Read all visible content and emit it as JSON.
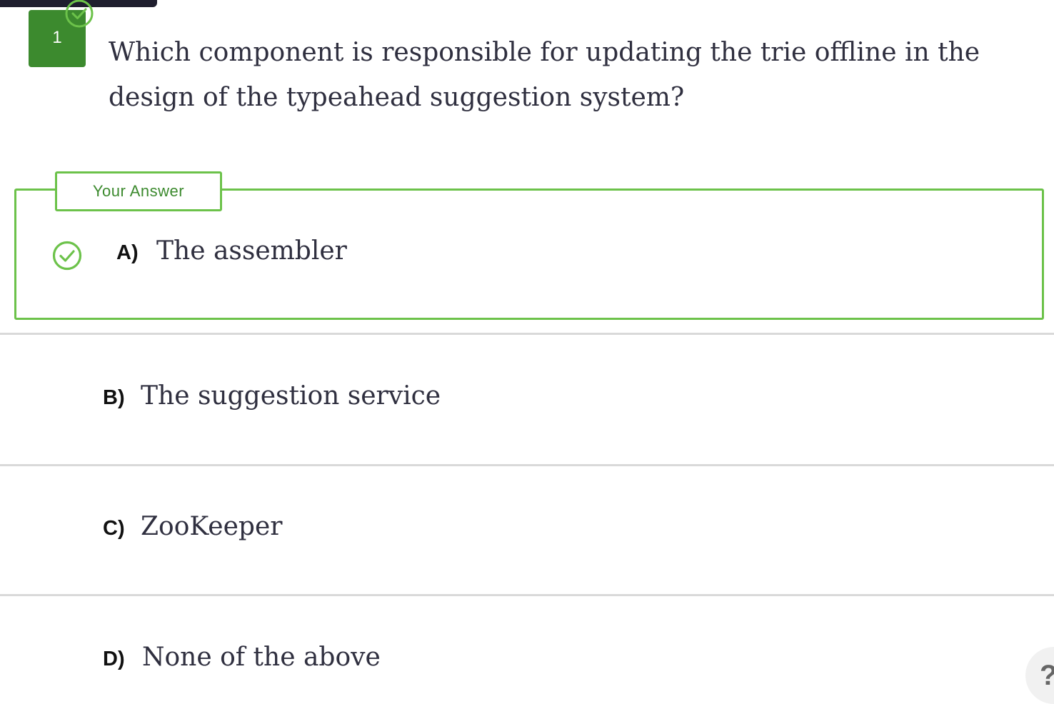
{
  "question": {
    "number": "1",
    "text": "Which component is responsible for updating the trie offline in the design of the typeahead suggestion system?"
  },
  "your_answer_label": "Your Answer",
  "options": [
    {
      "letter": "A)",
      "text": "The assembler",
      "selected": true,
      "correct": true
    },
    {
      "letter": "B)",
      "text": "The suggestion service",
      "selected": false
    },
    {
      "letter": "C)",
      "text": "ZooKeeper",
      "selected": false
    },
    {
      "letter": "D)",
      "text": "None of the above",
      "selected": false
    }
  ],
  "help": {
    "label": "?",
    "icon": "question-mark-icon"
  },
  "colors": {
    "accent_green": "#6cc24a",
    "badge_green": "#3c8a2e",
    "text_dark": "#2f2f3f",
    "divider": "#d9d9d9"
  }
}
